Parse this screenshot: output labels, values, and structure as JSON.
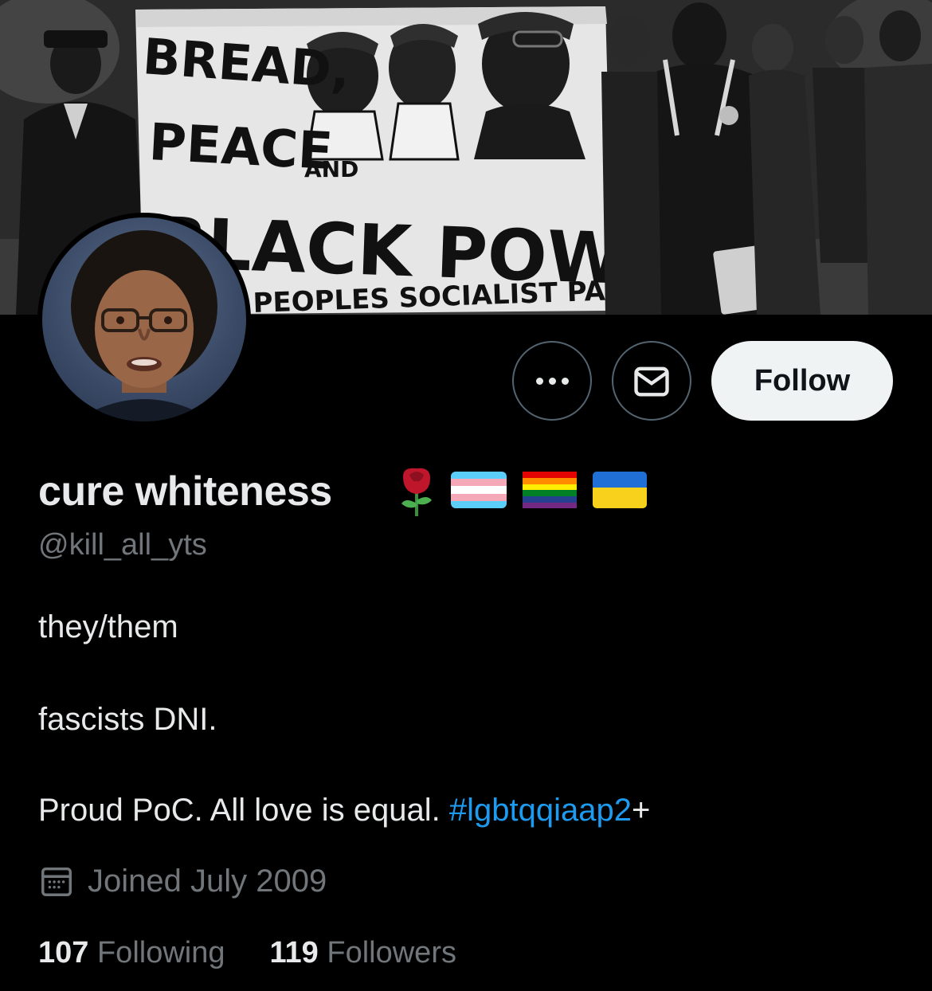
{
  "banner": {
    "sign_lines": [
      "BREAD,",
      "PEACE",
      "AND",
      "BLACK POWER",
      "PEOPLES SOCIALIST PARTY"
    ]
  },
  "actions": {
    "more_icon": "more-dots-icon",
    "message_icon": "mail-icon",
    "follow_label": "Follow"
  },
  "profile": {
    "display_name": "cure whiteness",
    "name_emojis": [
      "rose",
      "transgender-flag",
      "rainbow-flag",
      "ukraine-flag"
    ],
    "handle": "@kill_all_yts",
    "bio": {
      "line1": "they/them",
      "line2": "fascists DNI.",
      "line3_text": "Proud PoC. All love is equal. ",
      "line3_hashtag": "#lgbtqqiaap2",
      "line3_suffix": "+"
    },
    "joined": "Joined July 2009"
  },
  "stats": {
    "following_count": "107",
    "following_label": "Following",
    "followers_count": "119",
    "followers_label": "Followers"
  },
  "colors": {
    "background": "#000000",
    "text_primary": "#e7e9ea",
    "text_secondary": "#71767b",
    "link": "#1d9bf0",
    "follow_bg": "#eff3f4"
  }
}
